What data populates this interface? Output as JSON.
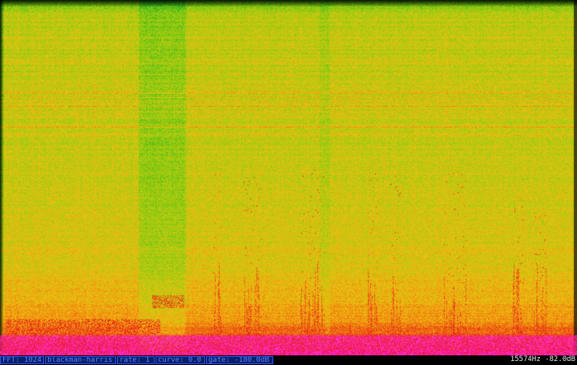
{
  "spectrogram": {
    "palette": [
      "#1ea81e",
      "#8fce10",
      "#f0bf10",
      "#ee7010",
      "#e81a1a",
      "#ff1aa8"
    ]
  },
  "status": {
    "fft": "FFT: 1024",
    "window": "blackman-harris",
    "rate": "rate: 1",
    "curve": "curve: 0.0",
    "gate": "gate: -180.0dB",
    "readout": "15574Hz -82.0dB"
  },
  "colors": {
    "status_border": "#2d58ff",
    "status_fill": "#0a1f66",
    "status_text": "#5d83ff",
    "readout_text": "#e8e8e8"
  }
}
